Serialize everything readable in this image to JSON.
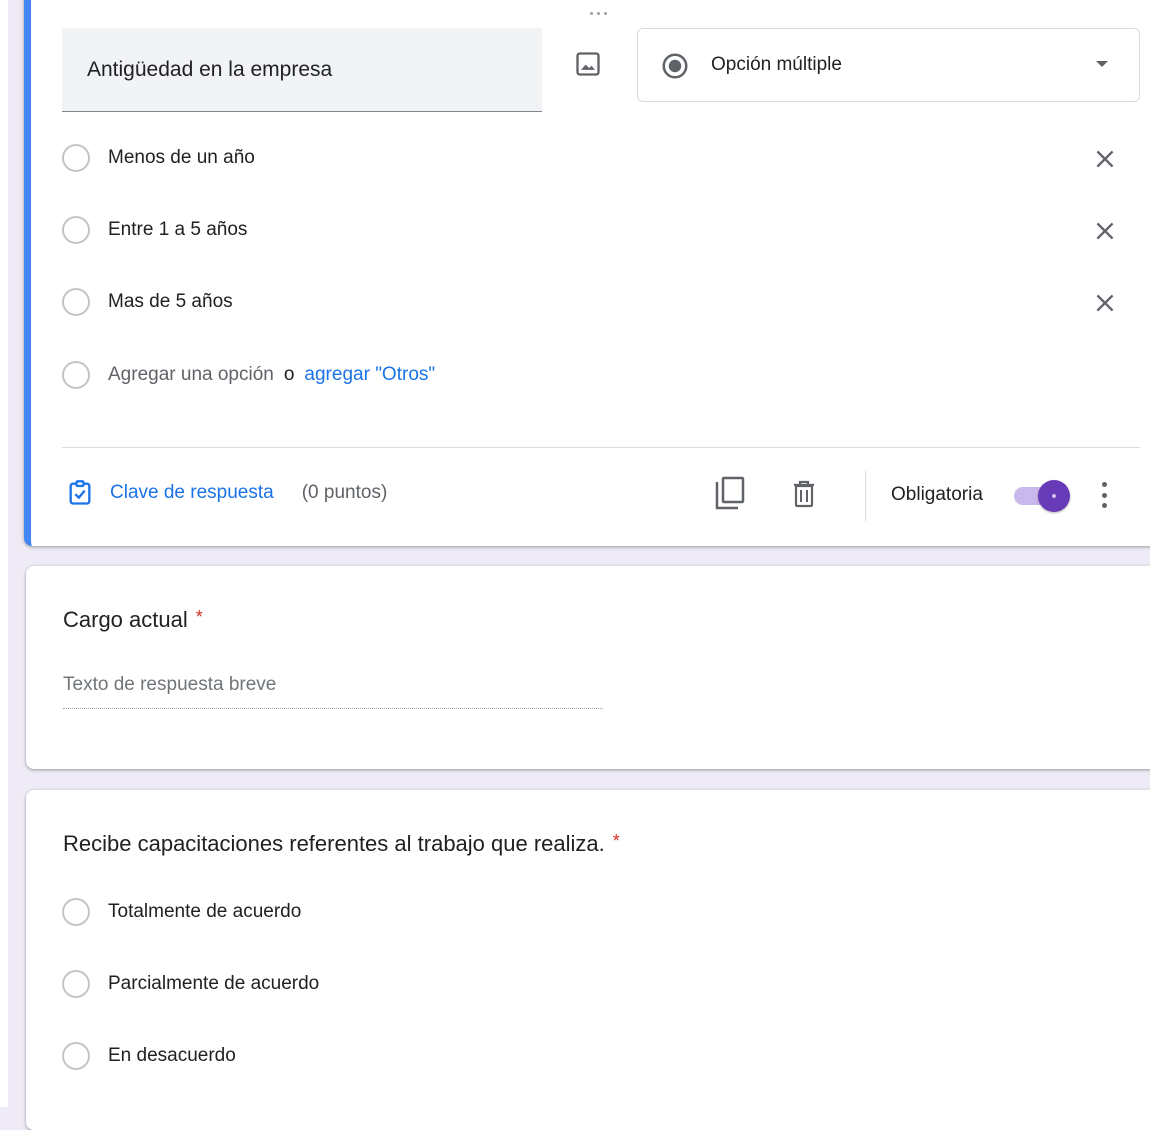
{
  "question_active": {
    "title": "Antigüedad en la empresa",
    "type_label": "Opción múltiple",
    "options": [
      "Menos de un año",
      "Entre 1 a 5 años",
      "Mas de 5 años"
    ],
    "add_option_label": "Agregar una opción",
    "or_label": "o",
    "add_other_label": "agregar \"Otros\"",
    "answer_key_label": "Clave de respuesta",
    "points_label": "(0 puntos)",
    "required_label": "Obligatoria",
    "required_on": true
  },
  "question_cargo": {
    "title": "Cargo actual",
    "required_mark": "*",
    "placeholder": "Texto de respuesta breve"
  },
  "question_capacitaciones": {
    "title": "Recibe capacitaciones referentes al trabajo que realiza.",
    "required_mark": "*",
    "options": [
      "Totalmente de acuerdo",
      "Parcialmente de acuerdo",
      "En desacuerdo"
    ]
  },
  "colors": {
    "accent_blue": "#4285f4",
    "link_blue": "#1a73e8",
    "toggle_purple": "#673ab7",
    "required_red": "#d93025",
    "background": "#efebf6"
  },
  "icons": [
    "drag-handle-icon",
    "image-icon",
    "radio-button-checked-icon",
    "dropdown-arrow-icon",
    "close-icon",
    "answer-key-icon",
    "copy-icon",
    "delete-icon",
    "more-vert-icon"
  ]
}
